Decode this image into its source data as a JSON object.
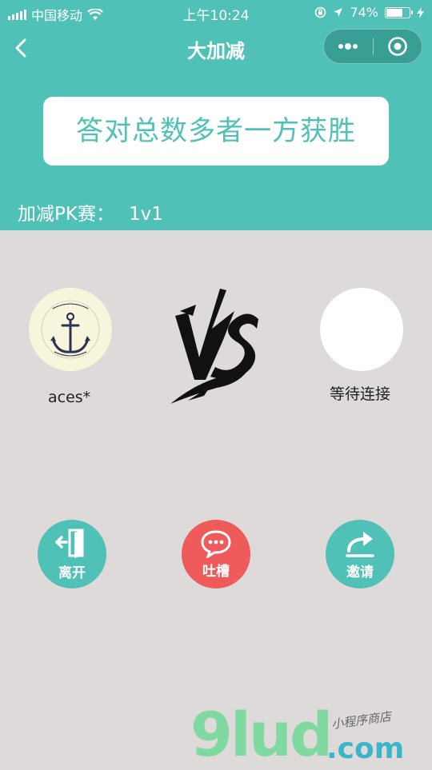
{
  "status_bar": {
    "carrier": "中国移动",
    "time": "上午10:24",
    "battery_text": "74%",
    "battery_level": 0.74
  },
  "nav": {
    "title": "大加减"
  },
  "header": {
    "rule_text": "答对总数多者一方获胜",
    "match_label": "加减PK赛：",
    "match_value": "1v1"
  },
  "players": {
    "left_name": "aces*",
    "right_name": "等待连接"
  },
  "actions": {
    "leave": "离开",
    "talk": "吐槽",
    "invite": "邀请"
  },
  "watermark": {
    "brand": "9lud",
    "domain": ".com",
    "tag": "小程序商店"
  },
  "colors": {
    "primary": "#4fc1b6",
    "accent_red": "#ef5a5b",
    "background": "#dedad9"
  }
}
